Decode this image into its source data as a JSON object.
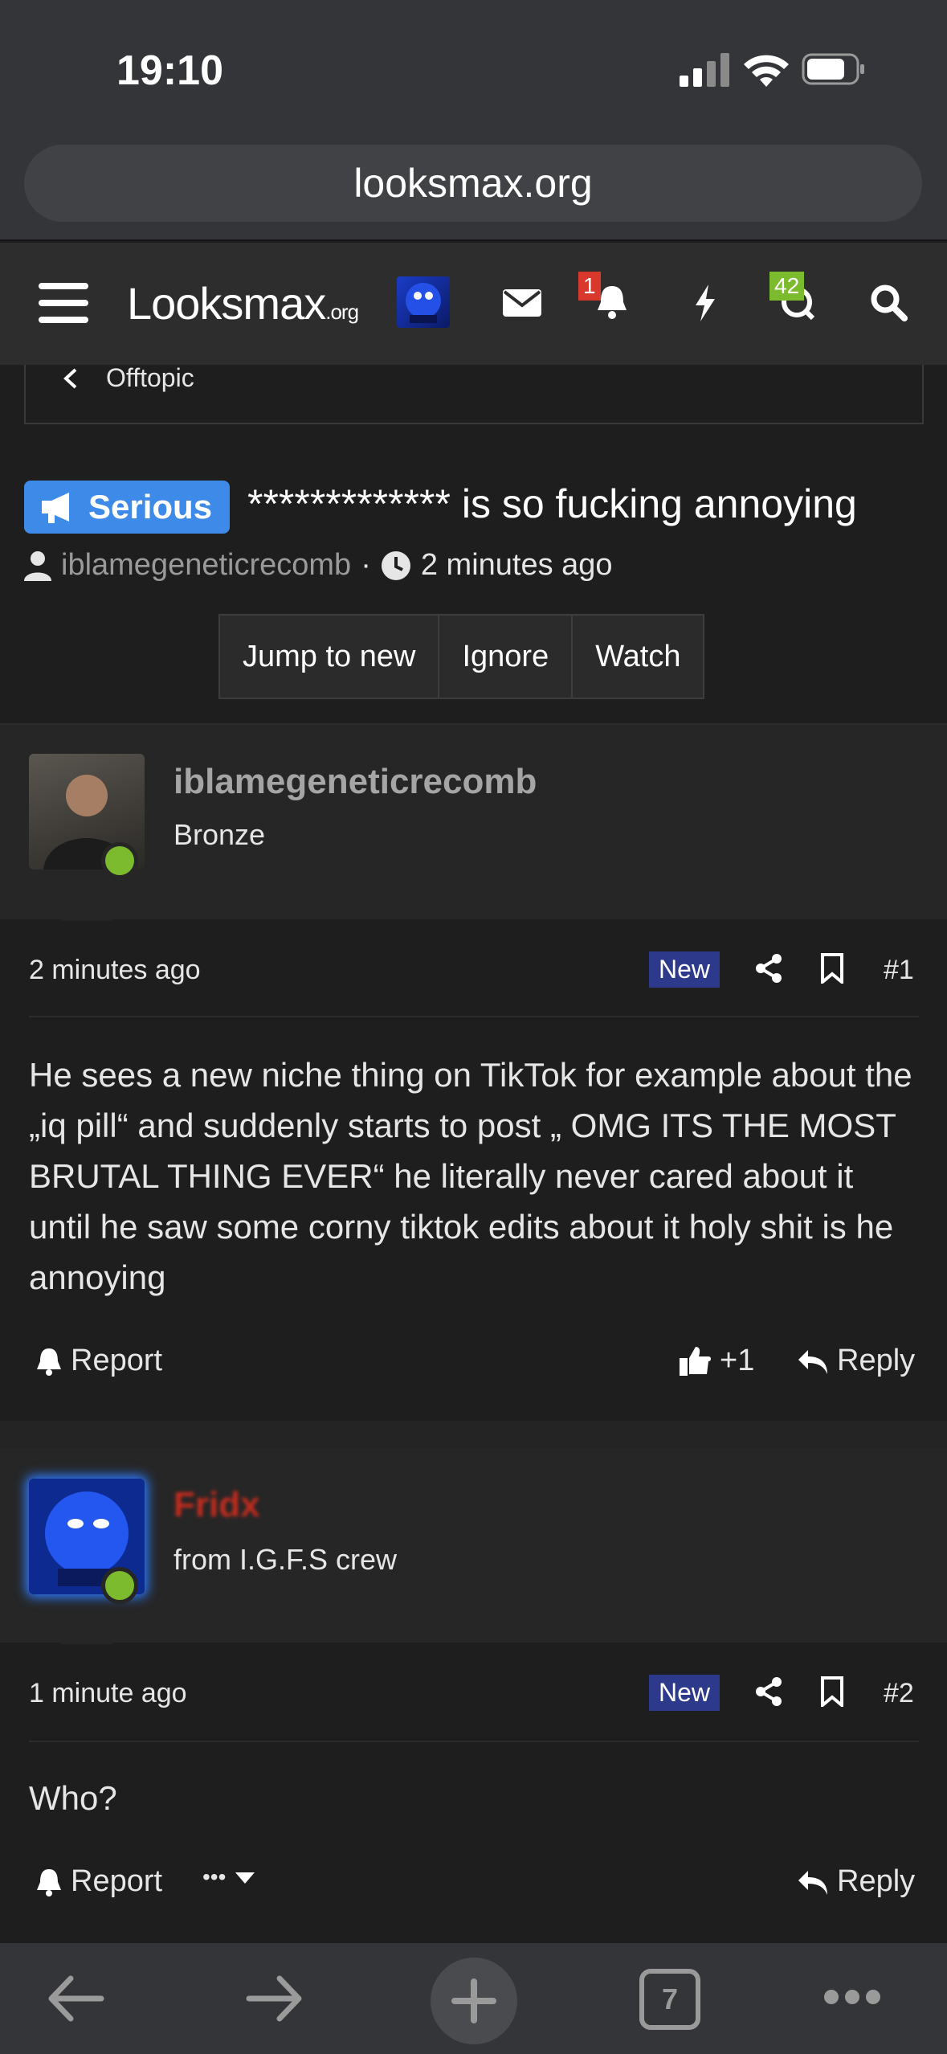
{
  "status": {
    "time": "19:10"
  },
  "browser": {
    "url": "looksmax.org",
    "tabs_count": "7"
  },
  "nav": {
    "logo_main": "Looksmax",
    "logo_suffix": ".org",
    "alerts_badge": "1",
    "conversations_badge": "42"
  },
  "breadcrumb": {
    "label": "Offtopic"
  },
  "thread": {
    "prefix": "Serious",
    "title": "************* is so fucking annoying",
    "author": "iblamegeneticrecomb",
    "separator": "·",
    "time": "2 minutes ago",
    "buttons": [
      "Jump to new",
      "Ignore",
      "Watch"
    ]
  },
  "posts": [
    {
      "username": "iblamegeneticrecomb",
      "user_title": "Bronze",
      "time": "2 minutes ago",
      "new_label": "New",
      "number": "#1",
      "body": "He sees a new niche thing on TikTok for example about the „iq pill“ and suddenly starts to post „ OMG ITS THE MOST BRUTAL THING EVER“ he literally never cared about it until he saw some corny tiktok edits about it holy shit is he annoying",
      "report_label": "Report",
      "reaction_count": "+1",
      "reply_label": "Reply"
    },
    {
      "username": "Fridx",
      "user_title": "from I.G.F.S crew",
      "time": "1 minute ago",
      "new_label": "New",
      "number": "#2",
      "body": "Who?",
      "report_label": "Report",
      "more_label": "•••",
      "reply_label": "Reply"
    }
  ],
  "colors": {
    "accent": "#3e8ae8",
    "online": "#7dbb2e",
    "new_tag": "#2d3a8c",
    "alert_badge": "#d9382c",
    "conv_badge": "#7dbb2e"
  }
}
